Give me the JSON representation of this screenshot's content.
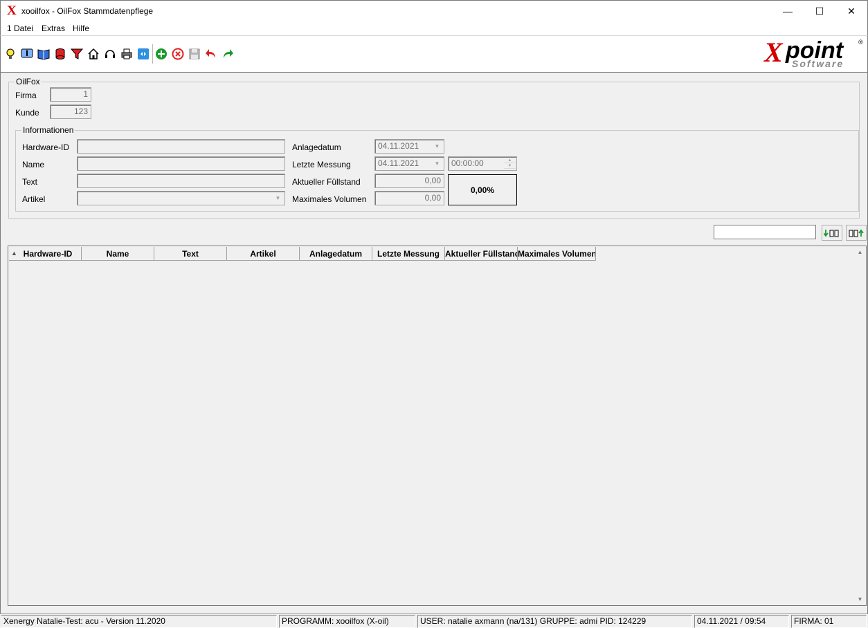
{
  "window": {
    "title": "xooilfox - OilFox Stammdatenpflege"
  },
  "menu": {
    "items": [
      "1 Datei",
      "Extras",
      "Hilfe"
    ]
  },
  "toolbar": {
    "icons": [
      "lightbulb-icon",
      "info-icon",
      "book-icon",
      "database-icon",
      "filter-icon",
      "home-icon",
      "headset-icon",
      "printer-icon",
      "remote-icon",
      "add-icon",
      "delete-icon",
      "save-icon",
      "undo-icon",
      "redo-icon"
    ],
    "logo": {
      "brand_x": "X",
      "brand_point": "point",
      "sub": "Software",
      "reg": "®"
    }
  },
  "oilfox_group": {
    "legend": "OilFox",
    "firma_label": "Firma",
    "firma_value": "1",
    "kunde_label": "Kunde",
    "kunde_value": "123"
  },
  "info_group": {
    "legend": "Informationen",
    "hardware_id_label": "Hardware-ID",
    "hardware_id_value": "",
    "name_label": "Name",
    "name_value": "",
    "text_label": "Text",
    "text_value": "",
    "artikel_label": "Artikel",
    "artikel_value": "",
    "anlagedatum_label": "Anlagedatum",
    "anlagedatum_value": "04.11.2021",
    "letzte_messung_label": "Letzte Messung",
    "letzte_messung_date": "04.11.2021",
    "letzte_messung_time": "00:00:00",
    "fuellstand_label": "Aktueller Füllstand",
    "fuellstand_value": "0,00",
    "volumen_label": "Maximales Volumen",
    "volumen_value": "0,00",
    "percent_display": "0,00%"
  },
  "search": {
    "value": ""
  },
  "grid": {
    "columns": [
      "Hardware-ID",
      "Name",
      "Text",
      "Artikel",
      "Anlagedatum",
      "Letzte Messung",
      "Aktueller Füllstand",
      "Maximales Volumen"
    ],
    "rows": []
  },
  "status": {
    "version": "Xenergy Natalie-Test: acu - Version 11.2020",
    "program": "PROGRAMM: xooilfox (X-oil)",
    "user": "USER: natalie axmann (na/131)  GRUPPE: admi  PID: 124229",
    "datetime": "04.11.2021 / 09:54",
    "firma": "FIRMA: 01"
  },
  "colors": {
    "brand_red": "#d10000",
    "add_green": "#1a9a2a",
    "delete_red": "#e02020"
  }
}
